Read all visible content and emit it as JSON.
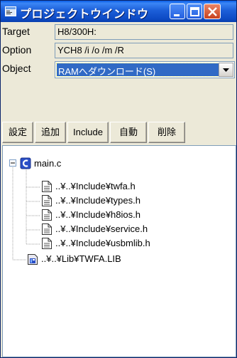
{
  "window": {
    "title": "プロジェクトウインドウ"
  },
  "fields": {
    "target": {
      "label": "Target",
      "value": "H8/300H:"
    },
    "option": {
      "label": "Option",
      "value": "YCH8 /i /o /m /R"
    },
    "object": {
      "label": "Object",
      "value": "RAMへダウンロード(S)"
    }
  },
  "toolbar": {
    "settings": "設定",
    "add": "追加",
    "include": "Include",
    "auto": "自動",
    "delete": "削除"
  },
  "tree": {
    "root": "main.c",
    "children": [
      "..¥..¥Include¥twfa.h",
      "..¥..¥Include¥types.h",
      "..¥..¥Include¥h8ios.h",
      "..¥..¥Include¥service.h",
      "..¥..¥Include¥usbmlib.h"
    ],
    "lib": "..¥..¥Lib¥TWFA.LIB"
  },
  "colors": {
    "titlebar": "#0d4ac4",
    "selection": "#316ac5",
    "window_bg": "#ece9d8",
    "close_button": "#c8421f"
  },
  "icons": {
    "app": "project-window-icon",
    "source": "c-source-icon",
    "header": "document-icon",
    "library": "library-icon",
    "expander": "minus-box-icon"
  }
}
